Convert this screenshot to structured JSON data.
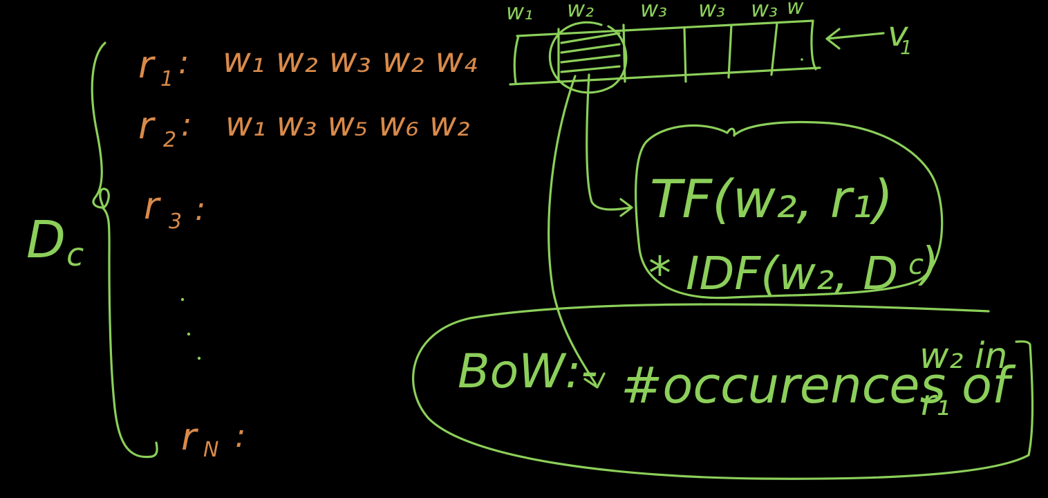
{
  "board": {
    "background": "#000000",
    "ink_colors": {
      "green": "#8ccf5a",
      "orange": "#d98a4a"
    }
  },
  "corpus": {
    "label_main": "D",
    "label_sub": "c",
    "reviews": [
      {
        "name": "r",
        "sub": "1",
        "colon": ":",
        "words": "w₁ w₂ w₃ w₂ w₄"
      },
      {
        "name": "r",
        "sub": "2",
        "colon": ":",
        "words": "w₁ w₃ w₅ w₆ w₂"
      },
      {
        "name": "r",
        "sub": "3",
        "colon": ":",
        "words": ""
      },
      {
        "name": "r",
        "sub": "N",
        "colon": ":",
        "words": ""
      }
    ]
  },
  "vector": {
    "headers": [
      "w₁",
      "w₂",
      "w₃",
      "w₃",
      "w₃",
      "w"
    ],
    "name": "v",
    "name_sub": "1"
  },
  "tfidf": {
    "line1": "TF(w₂, r₁)",
    "line2": "* IDF(w₂, D",
    "line2_sub": "c",
    "line2_close": ")"
  },
  "bow": {
    "label": "BoW:-",
    "text": "#occurences of",
    "word": "w₂ in",
    "review": "r₁"
  }
}
